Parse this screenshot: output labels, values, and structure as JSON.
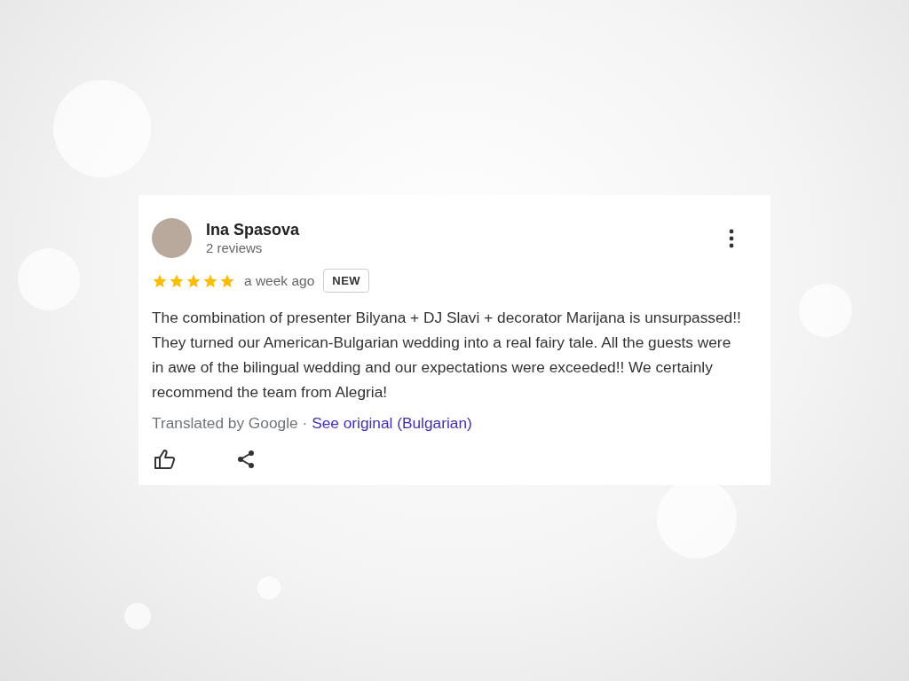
{
  "review": {
    "author": "Ina Spasova",
    "author_meta": "2 reviews",
    "stars": 5,
    "time": "a week ago",
    "badge": "NEW",
    "text": "The combination of presenter Bilyana + DJ Slavi + decorator Marijana is unsurpassed!! They turned our American-Bulgarian wedding into a real fairy tale. All the guests were in awe of the bilingual wedding and our expectations were exceeded!! We certainly recommend the team from Alegria!",
    "translation_note": "Translated by Google ·",
    "original_link": "See original (Bulgarian)"
  }
}
